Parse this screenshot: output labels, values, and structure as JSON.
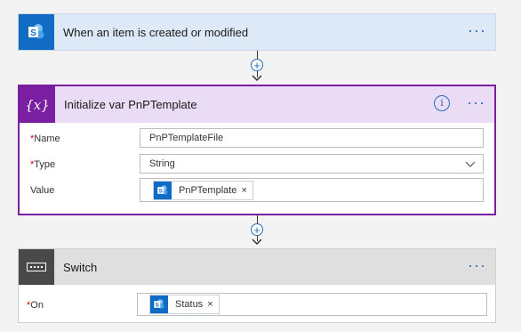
{
  "trigger": {
    "title": "When an item is created or modified",
    "more": "···",
    "icon": "sharepoint-icon",
    "header_color": "#dde9f6",
    "tile_color": "#0f6bc4"
  },
  "connector1": {
    "plus": "+"
  },
  "variable": {
    "icon_text": "{x}",
    "title": "Initialize var PnPTemplate",
    "info": "i",
    "more": "···",
    "accent": "#7b1fa2",
    "header_color": "#eadcf4",
    "name_label": "Name",
    "name_value": "PnPTemplateFile",
    "type_label": "Type",
    "type_value": "String",
    "value_label": "Value",
    "value_token": "PnPTemplate",
    "token_remove": "×",
    "required_mark": "*"
  },
  "connector2": {
    "plus": "+"
  },
  "switch": {
    "title": "Switch",
    "more": "···",
    "icon": "switch-icon",
    "header_color": "#dfdfdf",
    "tile_color": "#494949",
    "on_label": "On",
    "on_token": "Status",
    "token_remove": "×",
    "required_mark": "*"
  }
}
